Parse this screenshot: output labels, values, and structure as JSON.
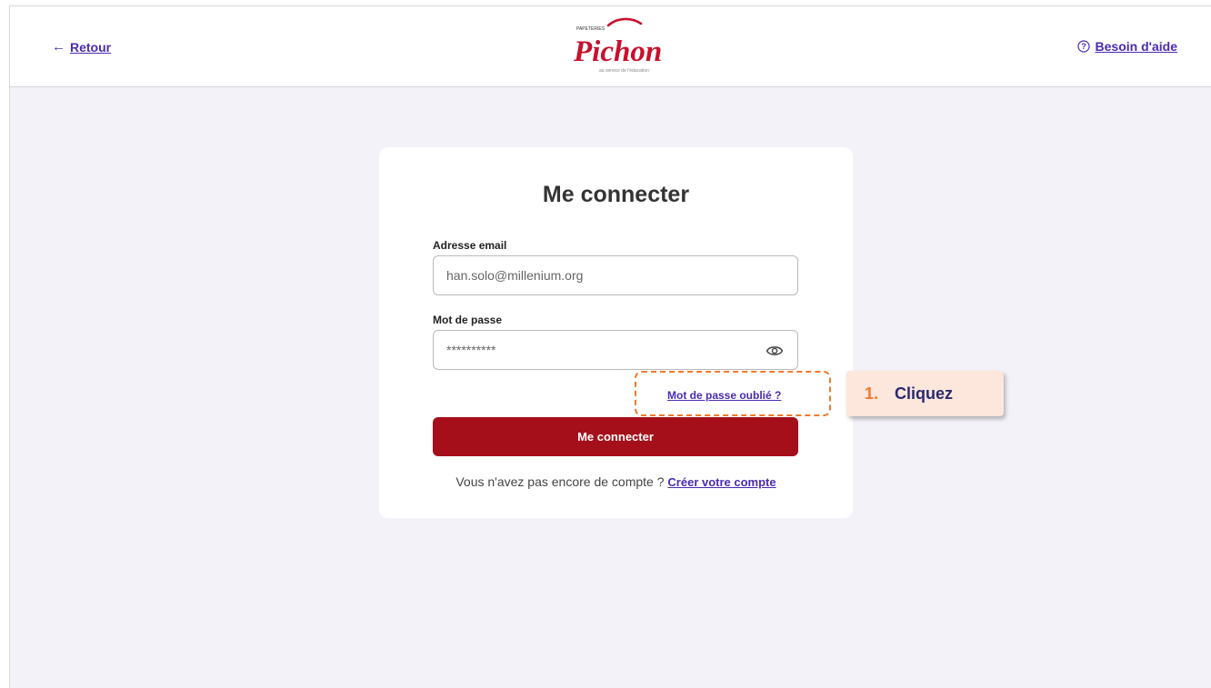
{
  "header": {
    "back_label": "Retour",
    "help_label": "Besoin d'aide",
    "logo": {
      "top_text": "PAPETERIES",
      "brand": "Pichon",
      "tagline": "au service de l'éducation"
    }
  },
  "login": {
    "title": "Me connecter",
    "email_label": "Adresse email",
    "email_value": "han.solo@millenium.org",
    "password_label": "Mot de passe",
    "password_value": "**********",
    "forgot_label": "Mot de passe oublié ?",
    "submit_label": "Me connecter",
    "no_account_text": "Vous n'avez pas encore de compte ?",
    "create_account_label": "Créer votre compte"
  },
  "callout": {
    "number": "1.",
    "text": "Cliquez"
  },
  "colors": {
    "accent": "#4b2bb3",
    "brand_red": "#a50f1a",
    "highlight": "#f07a2a",
    "callout_bg": "#fde6dc"
  },
  "icons": [
    "back-arrow-icon",
    "help-circle-icon",
    "eye-icon"
  ]
}
